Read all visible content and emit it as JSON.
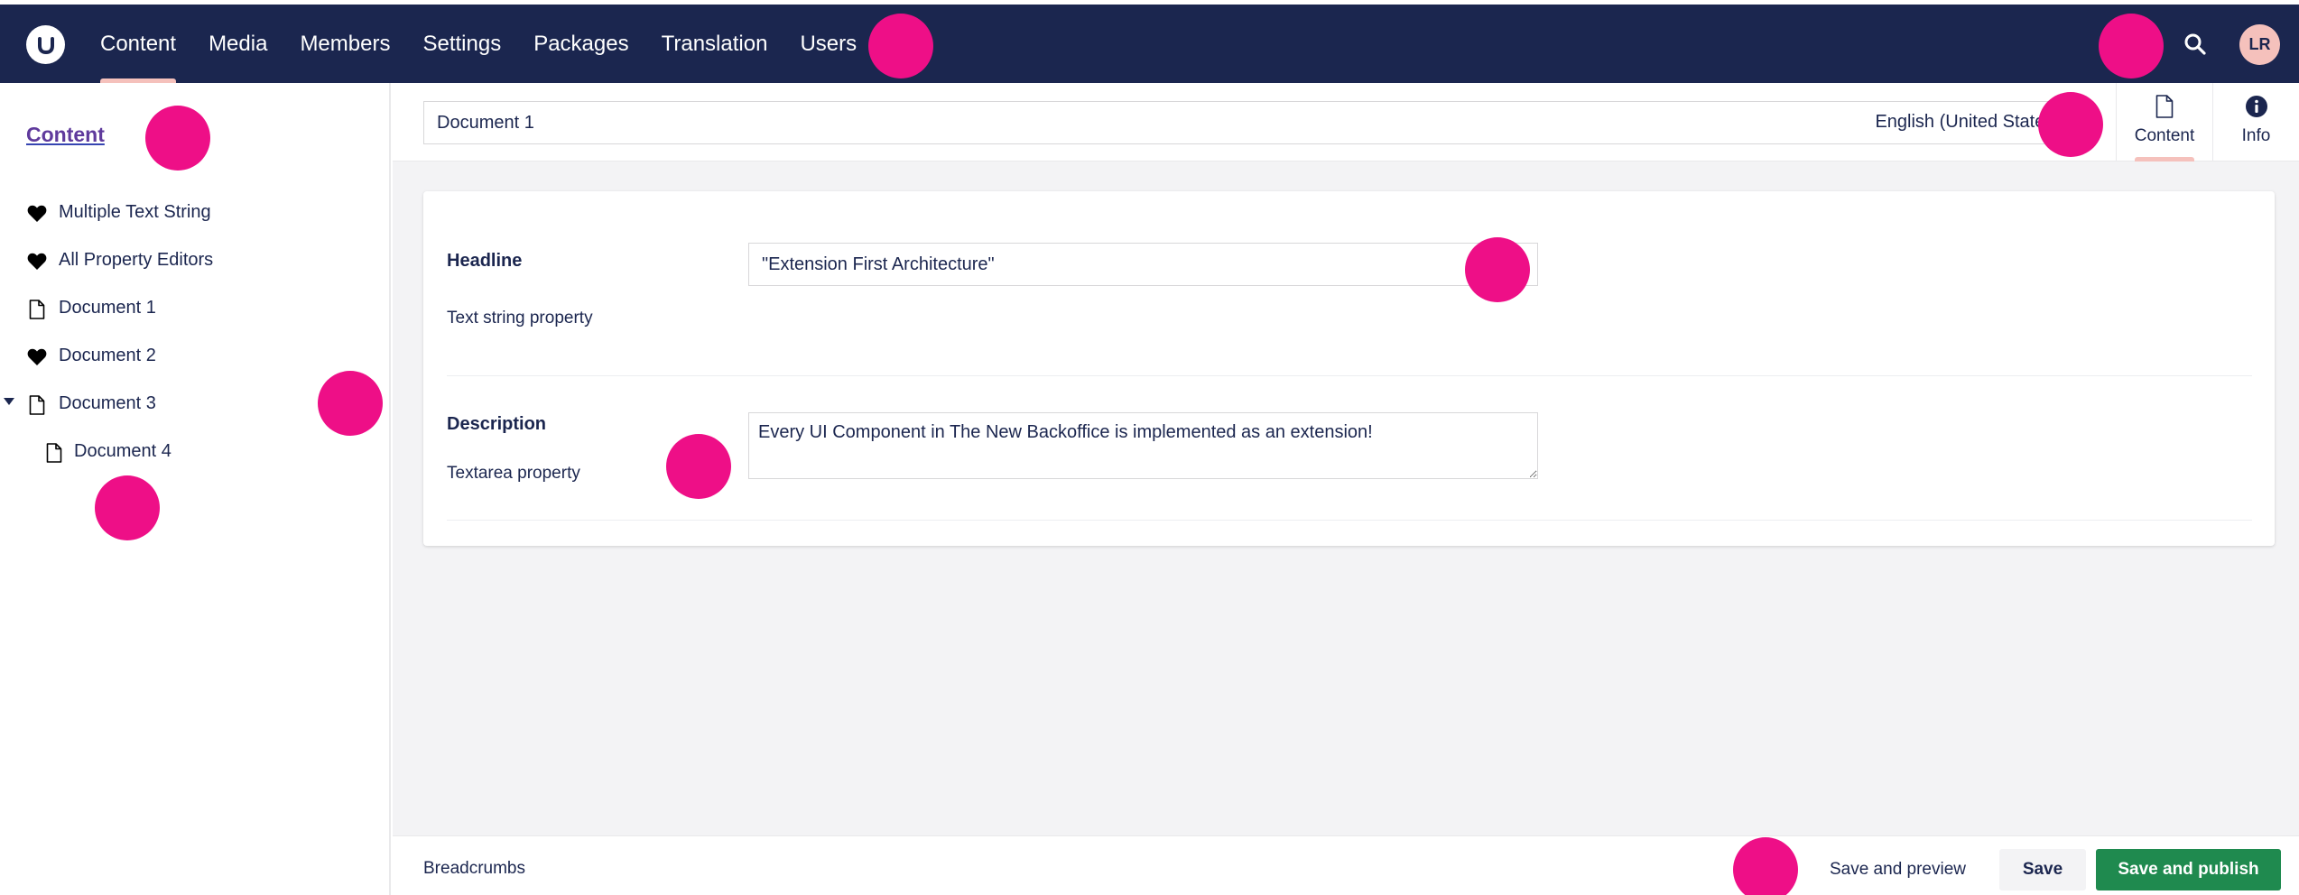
{
  "colors": {
    "header_bg": "#1b264f",
    "accent": "#f5c1bc",
    "publish_green": "#1f8a4f",
    "link_purple": "#5f3a9c",
    "marker_pink": "#ee0f87",
    "canvas_bg": "#f3f3f5"
  },
  "header": {
    "logo_icon": "umbraco-logo-icon",
    "nav": [
      {
        "label": "Content",
        "active": true
      },
      {
        "label": "Media",
        "active": false
      },
      {
        "label": "Members",
        "active": false
      },
      {
        "label": "Settings",
        "active": false
      },
      {
        "label": "Packages",
        "active": false
      },
      {
        "label": "Translation",
        "active": false
      },
      {
        "label": "Users",
        "active": false
      }
    ],
    "search_icon": "search-icon",
    "avatar_initials": "LR"
  },
  "sidebar": {
    "title": "Content",
    "tree": [
      {
        "label": "Multiple Text String",
        "icon": "heart-icon",
        "level": 0,
        "expanded": false
      },
      {
        "label": "All Property Editors",
        "icon": "heart-icon",
        "level": 0,
        "expanded": false
      },
      {
        "label": "Document 1",
        "icon": "document-icon",
        "level": 0,
        "expanded": false
      },
      {
        "label": "Document 2",
        "icon": "heart-icon",
        "level": 0,
        "expanded": false
      },
      {
        "label": "Document 3",
        "icon": "document-icon",
        "level": 0,
        "expanded": true
      },
      {
        "label": "Document 4",
        "icon": "document-icon",
        "level": 1,
        "expanded": false
      }
    ]
  },
  "editor": {
    "document_name": "Document 1",
    "culture": "English (United States)",
    "views": [
      {
        "label": "Content",
        "icon": "document-icon",
        "active": true
      },
      {
        "label": "Info",
        "icon": "info-icon",
        "active": false
      }
    ],
    "properties": [
      {
        "label": "Headline",
        "description": "Text string property",
        "value": "\"Extension First Architecture\""
      },
      {
        "label": "Description",
        "description": "Textarea property",
        "value": "Every UI Component in The New Backoffice is implemented as an extension!"
      }
    ]
  },
  "footer": {
    "breadcrumbs": "Breadcrumbs",
    "save_preview_label": "Save and preview",
    "save_label": "Save",
    "publish_label": "Save and publish"
  }
}
